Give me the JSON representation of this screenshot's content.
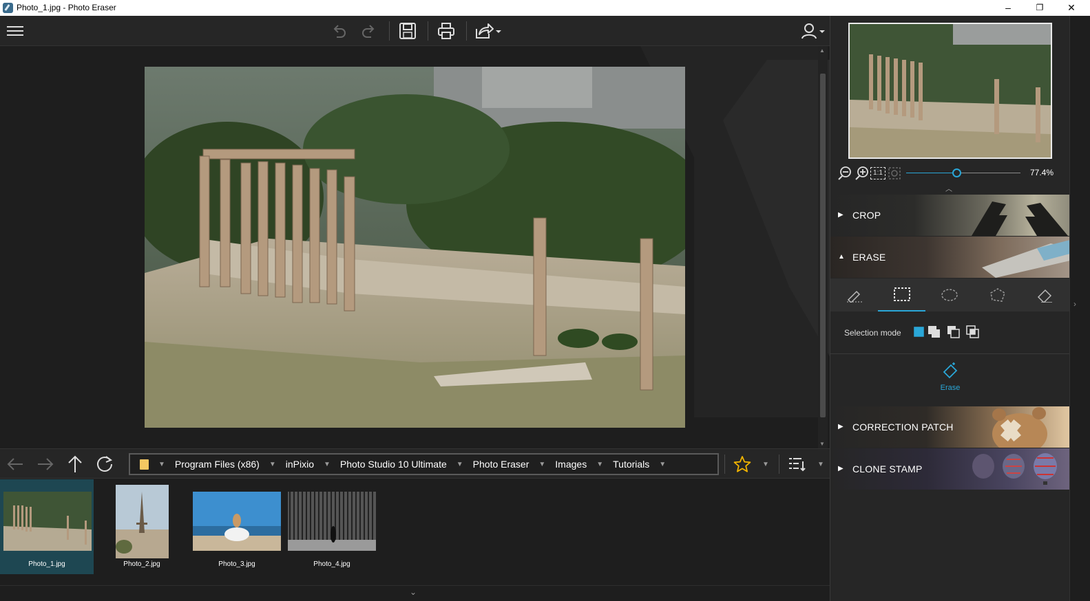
{
  "window": {
    "title": "Photo_1.jpg - Photo Eraser",
    "controls": {
      "minimize": "–",
      "maximize": "❐",
      "close": "✕"
    }
  },
  "toolbar": {
    "icons": [
      "menu-icon",
      "undo-icon",
      "redo-icon",
      "save-icon",
      "print-icon",
      "share-icon",
      "user-icon"
    ]
  },
  "navigation": {
    "breadcrumb": [
      "Program Files (x86)",
      "inPixio",
      "Photo Studio 10 Ultimate",
      "Photo Eraser",
      "Images",
      "Tutorials"
    ]
  },
  "filmstrip": {
    "items": [
      {
        "name": "Photo_1.jpg",
        "selected": true
      },
      {
        "name": "Photo_2.jpg",
        "selected": false
      },
      {
        "name": "Photo_3.jpg",
        "selected": false
      },
      {
        "name": "Photo_4.jpg",
        "selected": false
      }
    ]
  },
  "right_panel": {
    "zoom": {
      "value": "77.4%",
      "level": 0.44,
      "one_to_one": "1:1"
    },
    "sections": {
      "crop": "CROP",
      "erase": "ERASE",
      "correction_patch": "CORRECTION PATCH",
      "clone_stamp": "CLONE STAMP"
    },
    "selection_mode_label": "Selection mode",
    "erase_button": "Erase"
  },
  "colors": {
    "accent": "#2aa7d8",
    "selected_thumb": "#1e4752",
    "background": "#1e1e1e",
    "panel": "#262626",
    "star": "#f2b400"
  }
}
